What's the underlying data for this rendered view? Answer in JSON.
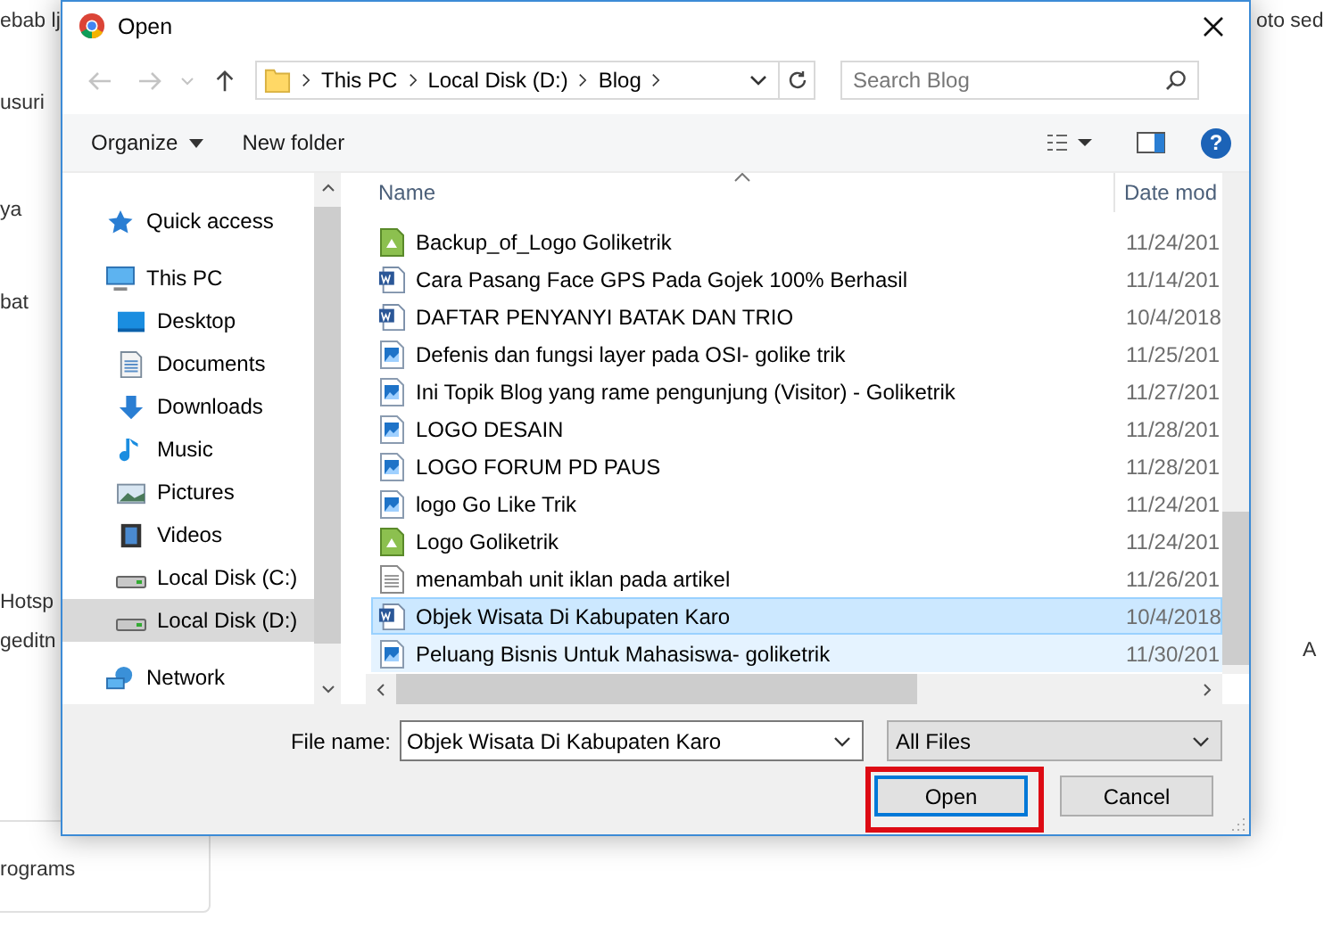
{
  "background_page": {
    "texts": [
      "ebab lj",
      "oto sed",
      "usuri",
      "ya",
      "bat",
      "Hotsp",
      "geditn",
      "A",
      "rograms"
    ]
  },
  "window": {
    "title": "Open"
  },
  "address_bar": {
    "crumbs": [
      "This PC",
      "Local Disk (D:)",
      "Blog"
    ]
  },
  "search": {
    "placeholder": "Search Blog"
  },
  "toolbar": {
    "organize": "Organize",
    "new_folder": "New folder",
    "help": "?"
  },
  "sidebar": {
    "items": [
      {
        "label": "Quick access",
        "selected": false
      },
      {
        "label": "This PC",
        "selected": false,
        "children": [
          {
            "label": "Desktop",
            "selected": false
          },
          {
            "label": "Documents",
            "selected": false
          },
          {
            "label": "Downloads",
            "selected": false
          },
          {
            "label": "Music",
            "selected": false
          },
          {
            "label": "Pictures",
            "selected": false
          },
          {
            "label": "Videos",
            "selected": false
          },
          {
            "label": "Local Disk (C:)",
            "selected": false
          },
          {
            "label": "Local Disk (D:)",
            "selected": true
          }
        ]
      },
      {
        "label": "Network",
        "selected": false
      }
    ]
  },
  "table": {
    "columns": [
      "Name",
      "Date mod"
    ],
    "rows": [
      {
        "name": "Backup_of_Logo Goliketrik",
        "date": "11/24/201",
        "kind": "green",
        "selected": false,
        "hovered": false
      },
      {
        "name": "Cara Pasang Face GPS Pada Gojek 100% Berhasil",
        "date": "11/14/201",
        "kind": "word",
        "selected": false,
        "hovered": false
      },
      {
        "name": "DAFTAR PENYANYI BATAK DAN TRIO",
        "date": "10/4/2018",
        "kind": "word",
        "selected": false,
        "hovered": false
      },
      {
        "name": "Defenis dan fungsi layer pada OSI- golike trik",
        "date": "11/25/201",
        "kind": "image",
        "selected": false,
        "hovered": false
      },
      {
        "name": "Ini Topik Blog yang rame pengunjung (Visitor) - Goliketrik",
        "date": "11/27/201",
        "kind": "image",
        "selected": false,
        "hovered": false
      },
      {
        "name": "LOGO DESAIN",
        "date": "11/28/201",
        "kind": "image",
        "selected": false,
        "hovered": false
      },
      {
        "name": "LOGO FORUM PD PAUS",
        "date": "11/28/201",
        "kind": "image",
        "selected": false,
        "hovered": false
      },
      {
        "name": "logo Go Like Trik",
        "date": "11/24/201",
        "kind": "image",
        "selected": false,
        "hovered": false
      },
      {
        "name": "Logo Goliketrik",
        "date": "11/24/201",
        "kind": "green",
        "selected": false,
        "hovered": false
      },
      {
        "name": "menambah unit iklan pada artikel",
        "date": "11/26/201",
        "kind": "text",
        "selected": false,
        "hovered": false
      },
      {
        "name": "Objek Wisata Di Kabupaten Karo",
        "date": "10/4/2018",
        "kind": "word",
        "selected": true,
        "hovered": false
      },
      {
        "name": "Peluang Bisnis Untuk Mahasiswa- goliketrik",
        "date": "11/30/201",
        "kind": "image",
        "selected": false,
        "hovered": true
      }
    ]
  },
  "file_name": {
    "label": "File name:",
    "value": "Objek Wisata Di Kabupaten Karo"
  },
  "file_type": {
    "value": "All Files"
  },
  "buttons": [
    {
      "label": "Open",
      "highlighted": true
    },
    {
      "label": "Cancel",
      "highlighted": false
    }
  ]
}
